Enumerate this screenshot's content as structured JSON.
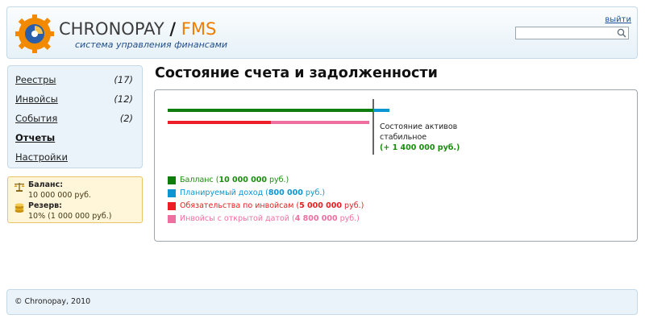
{
  "header": {
    "brand": "CHRONOPAY",
    "slash": "/",
    "product": "FMS",
    "tagline": "система управления финансами",
    "logout": "выйти",
    "search": {
      "value": "",
      "placeholder": ""
    }
  },
  "sidebar": {
    "items": [
      {
        "label": "Реестры",
        "count": "(17)"
      },
      {
        "label": "Инвойсы",
        "count": "(12)"
      },
      {
        "label": "События",
        "count": "(2)"
      },
      {
        "label": "Отчеты",
        "count": ""
      },
      {
        "label": "Настройки",
        "count": ""
      }
    ],
    "active": "Отчеты"
  },
  "balance": {
    "balance_label": "Баланс:",
    "balance_value": "10 000 000 руб.",
    "reserve_label": "Резерв:",
    "reserve_value": "10% (1 000 000 руб.)"
  },
  "main": {
    "title": "Состояние счета и задолженности",
    "status": {
      "line1": "Состояние активов",
      "line2": "стабильное",
      "value": "(+ 1 400 000 руб.)"
    },
    "legend": [
      {
        "prefix": "Балланс (",
        "amount": "10 000 000",
        "suffix": " руб.)",
        "color": "#0f7d0b",
        "text_color": "#1b8c0f"
      },
      {
        "prefix": "Планируемый доход (",
        "amount": "800 000",
        "suffix": " руб.)",
        "color": "#0b95d1",
        "text_color": "#0b95d1"
      },
      {
        "prefix": "Обязательства по инвойсам (",
        "amount": "5 000 000",
        "suffix": " руб.)",
        "color": "#ee1c25",
        "text_color": "#e61e1e"
      },
      {
        "prefix": "Инвойсы с открытой датой (",
        "amount": "4 800 000",
        "suffix": " руб.)",
        "color": "#ef6fa0",
        "text_color": "#ef6fa0"
      }
    ]
  },
  "chart_data": {
    "type": "bar",
    "series": [
      {
        "name": "Балланс",
        "values": [
          10000000
        ],
        "color": "#0f7d0b",
        "row": 1
      },
      {
        "name": "Планируемый доход",
        "values": [
          800000
        ],
        "color": "#0b95d1",
        "row": 1
      },
      {
        "name": "Обязательства по инвойсам",
        "values": [
          5000000
        ],
        "color": "#ee1c25",
        "row": 2
      },
      {
        "name": "Инвойсы с открытой датой",
        "values": [
          4800000
        ],
        "color": "#ef6fa0",
        "row": 2
      }
    ]
  },
  "footer": {
    "copyright": "© Chronopay, 2010"
  }
}
